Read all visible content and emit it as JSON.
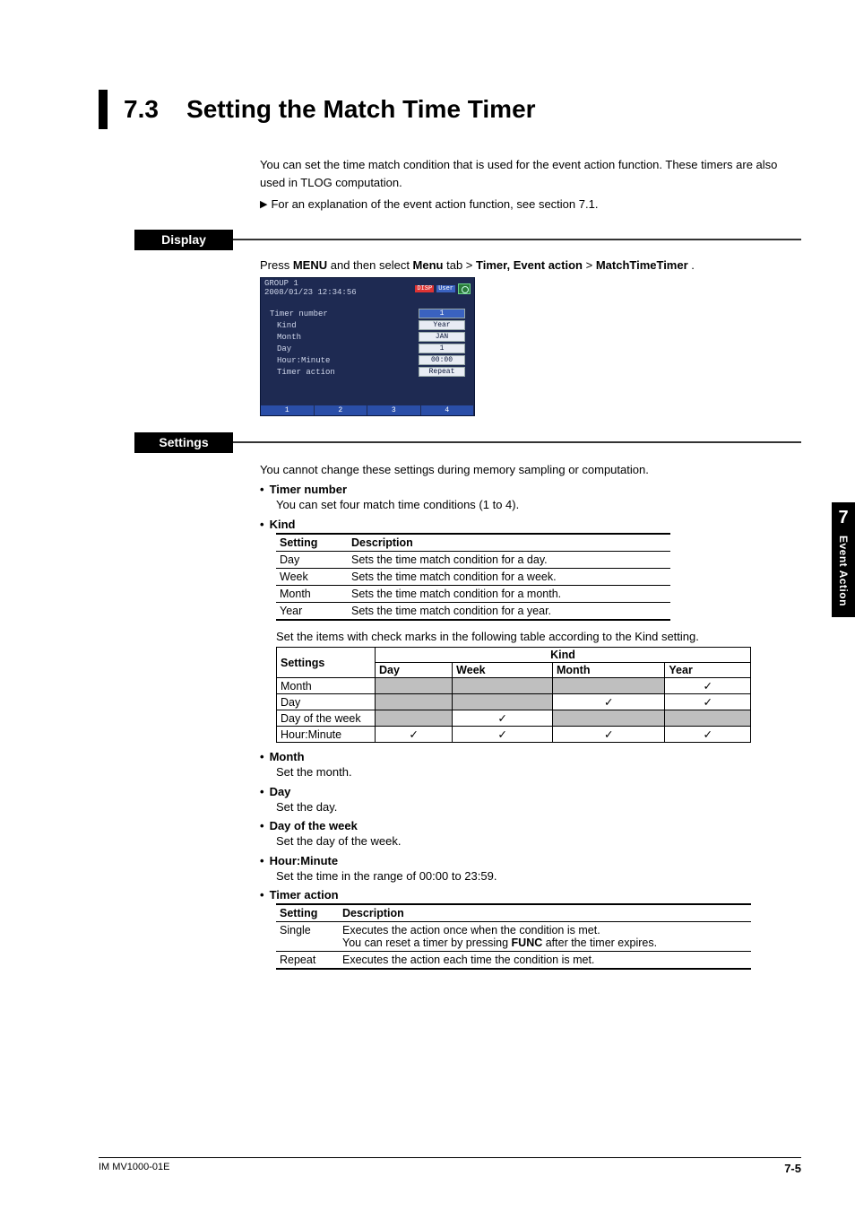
{
  "title": {
    "number": "7.3",
    "text": "Setting the Match Time Timer"
  },
  "intro": {
    "p1": "You can set the time match condition that is used for the event action function. These timers are also used in TLOG computation.",
    "p2": "For an explanation of the event action function, see section 7.1."
  },
  "display": {
    "label": "Display",
    "breadcrumb": {
      "prefix": "Press ",
      "menu": "MENU",
      "mid1": " and then select ",
      "tab": "Menu",
      "mid2": " tab > ",
      "item1": "Timer, Event action",
      "mid3": " > ",
      "item2": "MatchTimeTimer",
      "suffix": "."
    },
    "screenshot": {
      "group": "GROUP 1",
      "timestamp": "2008/01/23 12:34:56",
      "disp": "DISP",
      "user": "User",
      "timer_number_label": "Timer number",
      "timer_number_value": "1",
      "rows": [
        {
          "label": "Kind",
          "value": "Year"
        },
        {
          "label": "Month",
          "value": "JAN"
        },
        {
          "label": "Day",
          "value": "1"
        },
        {
          "label": "Hour:Minute",
          "value": "00:00"
        },
        {
          "label": "Timer action",
          "value": "Repeat"
        }
      ],
      "tabs": [
        "1",
        "2",
        "3",
        "4"
      ]
    }
  },
  "settings": {
    "label": "Settings",
    "note": "You cannot change these settings during memory sampling or computation.",
    "timer_number": {
      "head": "Timer number",
      "desc": "You can set four match time conditions (1 to 4)."
    },
    "kind": {
      "head": "Kind",
      "table_headers": {
        "c1": "Setting",
        "c2": "Description"
      },
      "rows": [
        {
          "c1": "Day",
          "c2": "Sets the time match condition for a day."
        },
        {
          "c1": "Week",
          "c2": "Sets the time match condition for a week."
        },
        {
          "c1": "Month",
          "c2": "Sets the time match condition for a month."
        },
        {
          "c1": "Year",
          "c2": "Sets the time match condition for a year."
        }
      ],
      "note": "Set the items with check marks in the following table according to the Kind setting.",
      "matrix": {
        "row_header": "Settings",
        "kind_header": "Kind",
        "cols": [
          "Day",
          "Week",
          "Month",
          "Year"
        ],
        "rows": [
          {
            "name": "Month",
            "cells": [
              0,
              0,
              0,
              1
            ]
          },
          {
            "name": "Day",
            "cells": [
              0,
              0,
              1,
              1
            ]
          },
          {
            "name": "Day of the week",
            "cells": [
              0,
              1,
              0,
              0
            ]
          },
          {
            "name": "Hour:Minute",
            "cells": [
              1,
              1,
              1,
              1
            ]
          }
        ]
      }
    },
    "month": {
      "head": "Month",
      "desc": "Set the month."
    },
    "day": {
      "head": "Day",
      "desc": "Set the day."
    },
    "dow": {
      "head": "Day of the week",
      "desc": "Set the day of the week."
    },
    "hm": {
      "head": "Hour:Minute",
      "desc": "Set the time in the range of 00:00 to 23:59."
    },
    "timer_action": {
      "head": "Timer action",
      "table_headers": {
        "c1": "Setting",
        "c2": "Description"
      },
      "rows": [
        {
          "c1": "Single",
          "c2a": "Executes the action once when the condition is met.",
          "c2b_pre": "You can reset a timer by pressing ",
          "c2b_bold": "FUNC",
          "c2b_post": " after the timer expires."
        },
        {
          "c1": "Repeat",
          "c2": "Executes the action each time the condition is met."
        }
      ]
    }
  },
  "sidebar": {
    "chapter": "7",
    "label": "Event Action"
  },
  "footer": {
    "left": "IM MV1000-01E",
    "right": "7-5"
  },
  "glyphs": {
    "check": "✓",
    "arrow": "▶"
  }
}
